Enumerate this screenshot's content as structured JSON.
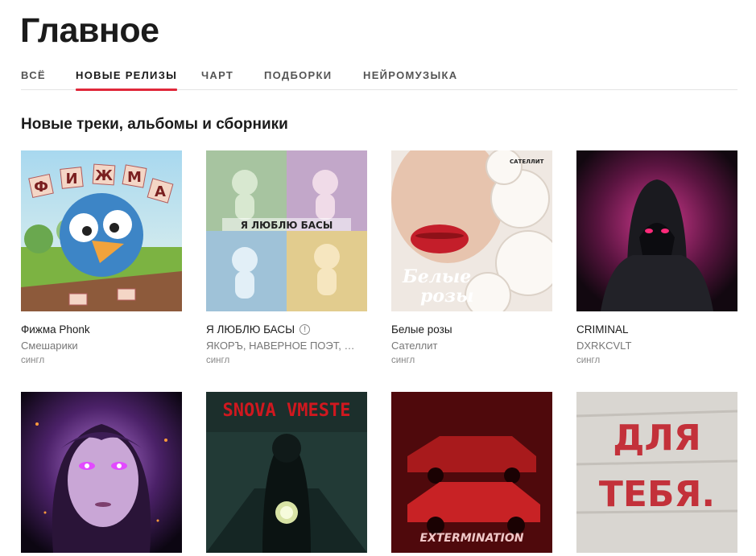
{
  "page": {
    "title": "Главное"
  },
  "tabs": [
    {
      "label": "ВСЁ",
      "active": false
    },
    {
      "label": "НОВЫЕ РЕЛИЗЫ",
      "active": true
    },
    {
      "label": "ЧАРТ",
      "active": false
    },
    {
      "label": "ПОДБОРКИ",
      "active": false
    },
    {
      "label": "НЕЙРОМУЗЫКА",
      "active": false
    }
  ],
  "section": {
    "title": "Новые треки, альбомы и сборники"
  },
  "colors": {
    "accent": "#e0283a"
  },
  "releases": [
    {
      "title": "Фижма Phonk",
      "artist": "Смешарики",
      "type": "сингл",
      "cover_letters": [
        "Ф",
        "И",
        "Ж",
        "М",
        "А"
      ]
    },
    {
      "title": "Я ЛЮБЛЮ БАСЫ",
      "artist": "ЯКОРЪ, НАВЕРНОЕ ПОЭТ, Е...",
      "type": "сингл",
      "info_icon": "info-icon",
      "cover_text": "Я ЛЮБЛЮ БАСЫ"
    },
    {
      "title": "Белые розы",
      "artist": "Сателлит",
      "type": "сингл",
      "cover_text": "Белые розы",
      "cover_label": "САТЕЛЛИТ"
    },
    {
      "title": "CRIMINAL",
      "artist": "DXRKCVLT",
      "type": "сингл"
    },
    {
      "title": "",
      "artist": "",
      "type": ""
    },
    {
      "title": "",
      "artist": "",
      "type": "",
      "cover_text": "SNOVA VMESTE"
    },
    {
      "title": "",
      "artist": "",
      "type": "",
      "cover_text": "EXTERMINATION"
    },
    {
      "title": "",
      "artist": "",
      "type": "",
      "cover_text": "ДЛЯ ТЕБЯ."
    }
  ]
}
